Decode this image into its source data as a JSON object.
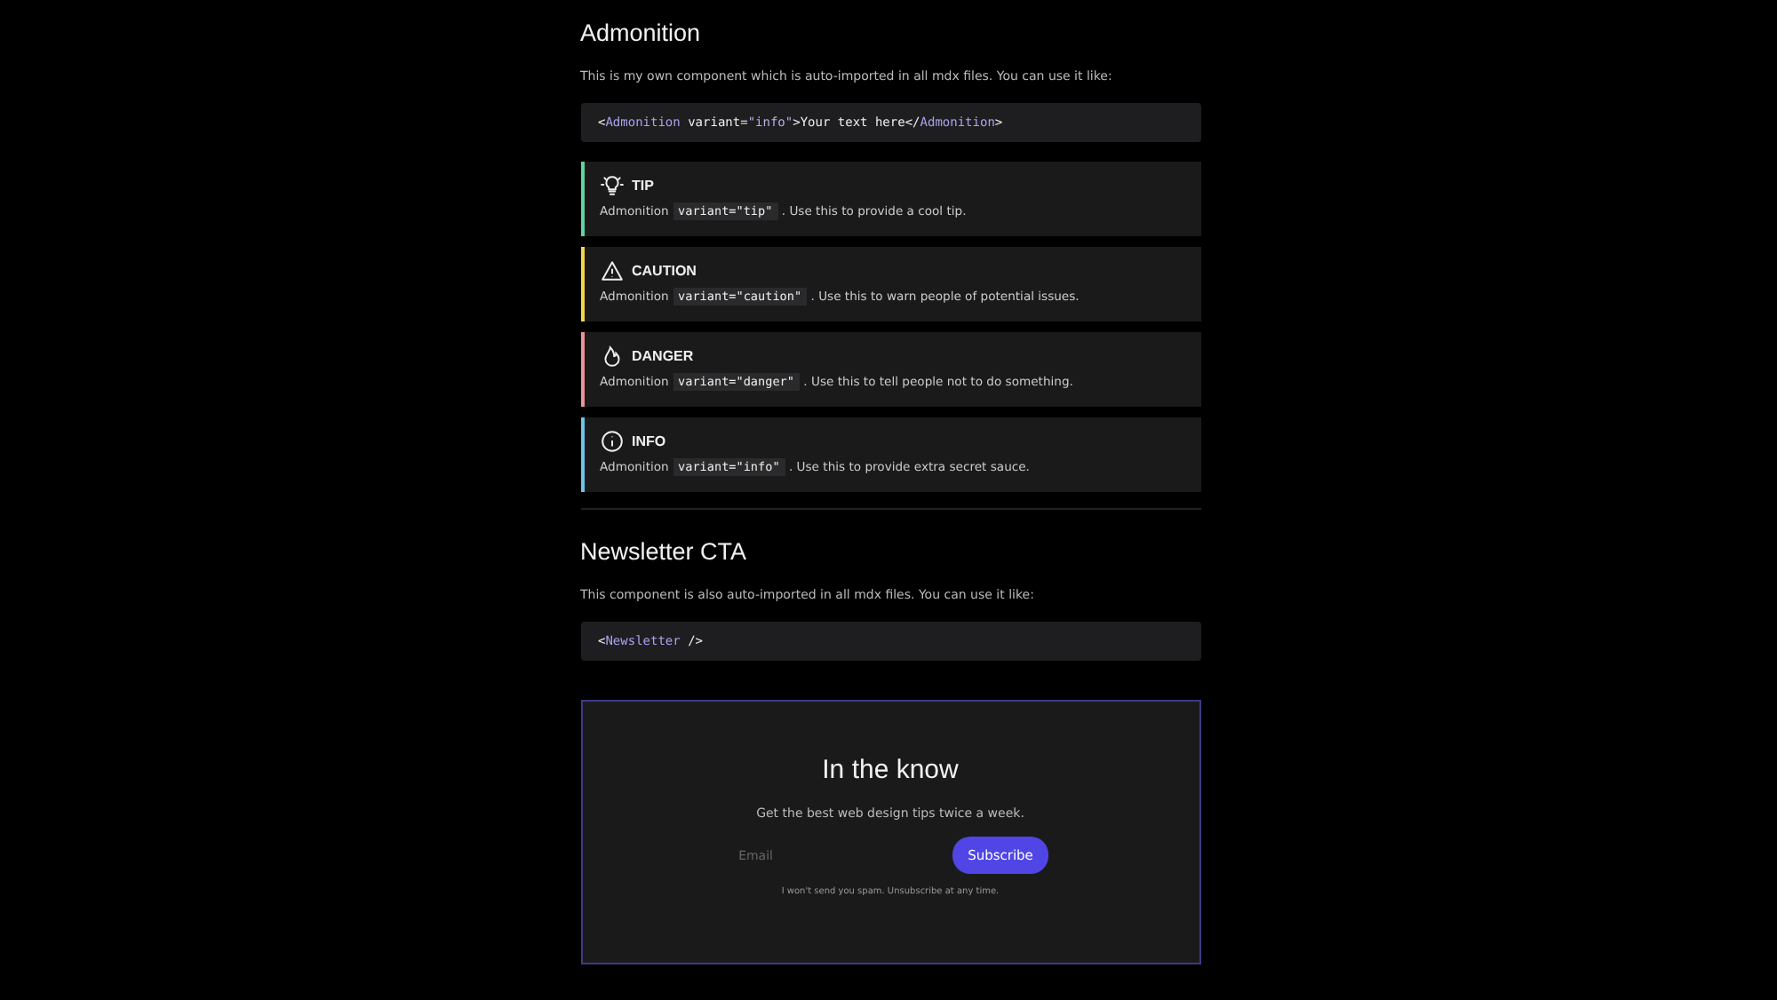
{
  "sections": [
    {
      "heading": "Admonition",
      "intro": "This is my own component which is auto-imported in all mdx files. You can use it like:",
      "code": [
        {
          "kind": "punct",
          "text": "<"
        },
        {
          "kind": "tag",
          "text": "Admonition"
        },
        {
          "kind": "plain",
          "text": " variant="
        },
        {
          "kind": "string",
          "text": "\"info\""
        },
        {
          "kind": "plain",
          "text": ">Your text here</"
        },
        {
          "kind": "tag",
          "text": "Admonition"
        },
        {
          "kind": "plain",
          "text": ">"
        }
      ],
      "admonitions": [
        {
          "kind": "tip",
          "title": "TIP",
          "color": "#5fd3a6",
          "before": "Admonition",
          "code": "variant=\"tip\"",
          "after": ". Use this to provide a cool tip."
        },
        {
          "kind": "caution",
          "title": "CAUTION",
          "color": "#f2d64b",
          "before": "Admonition",
          "code": "variant=\"caution\"",
          "after": ". Use this to warn people of potential issues."
        },
        {
          "kind": "danger",
          "title": "DANGER",
          "color": "#e8959a",
          "before": "Admonition",
          "code": "variant=\"danger\"",
          "after": ". Use this to tell people not to do something."
        },
        {
          "kind": "info",
          "title": "INFO",
          "color": "#6cc4e8",
          "before": "Admonition",
          "code": "variant=\"info\"",
          "after": ". Use this to provide extra secret sauce."
        }
      ]
    },
    {
      "heading": "Newsletter CTA",
      "intro": "This component is also auto-imported in all mdx files. You can use it like:",
      "code": [
        {
          "kind": "punct",
          "text": "<"
        },
        {
          "kind": "tag",
          "text": "Newsletter"
        },
        {
          "kind": "plain",
          "text": " />"
        }
      ]
    }
  ],
  "newsletter": {
    "title": "In the know",
    "subtitle": "Get the best web design tips twice a week.",
    "email": {
      "placeholder": "Email"
    },
    "button": "Subscribe",
    "note": "I won't send you spam. Unsubscribe at any time."
  }
}
